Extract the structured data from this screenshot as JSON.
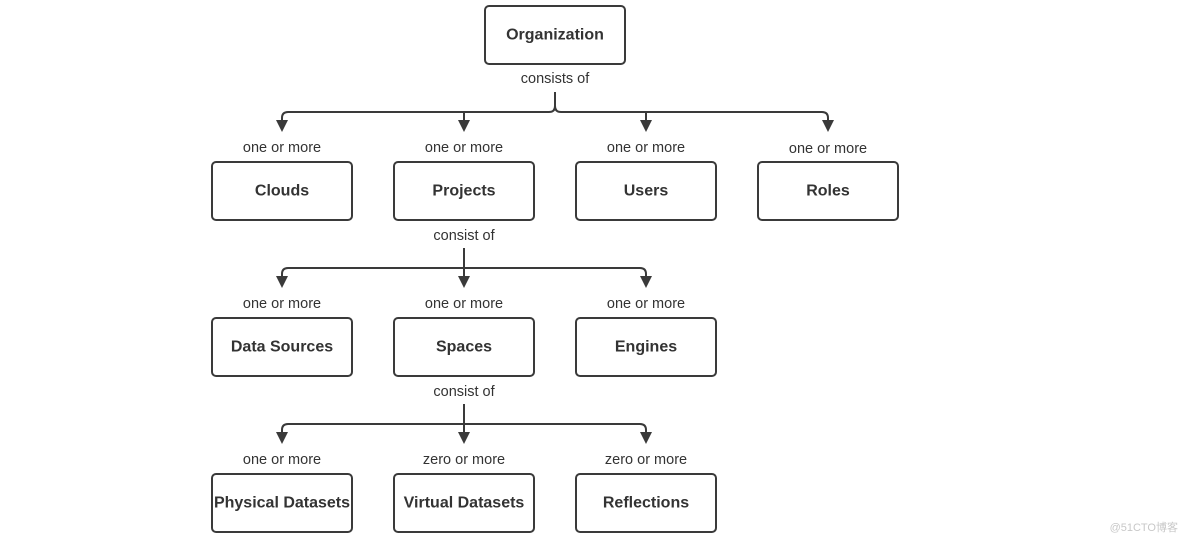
{
  "diagram": {
    "root": "Organization",
    "root_edge": "consists of",
    "level1": [
      {
        "label": "Clouds",
        "cardinality": "one or more"
      },
      {
        "label": "Projects",
        "cardinality": "one or more"
      },
      {
        "label": "Users",
        "cardinality": "one or more"
      },
      {
        "label": "Roles",
        "cardinality": "one or more"
      }
    ],
    "projects_edge": "consist of",
    "level2": [
      {
        "label": "Data Sources",
        "cardinality": "one or more"
      },
      {
        "label": "Spaces",
        "cardinality": "one or more"
      },
      {
        "label": "Engines",
        "cardinality": "one or more"
      }
    ],
    "spaces_edge": "consist of",
    "level3": [
      {
        "label": "Physical Datasets",
        "cardinality": "one or more"
      },
      {
        "label": "Virtual Datasets",
        "cardinality": "zero or more"
      },
      {
        "label": "Reflections",
        "cardinality": "zero or more"
      }
    ],
    "watermark": "@51CTO博客"
  }
}
